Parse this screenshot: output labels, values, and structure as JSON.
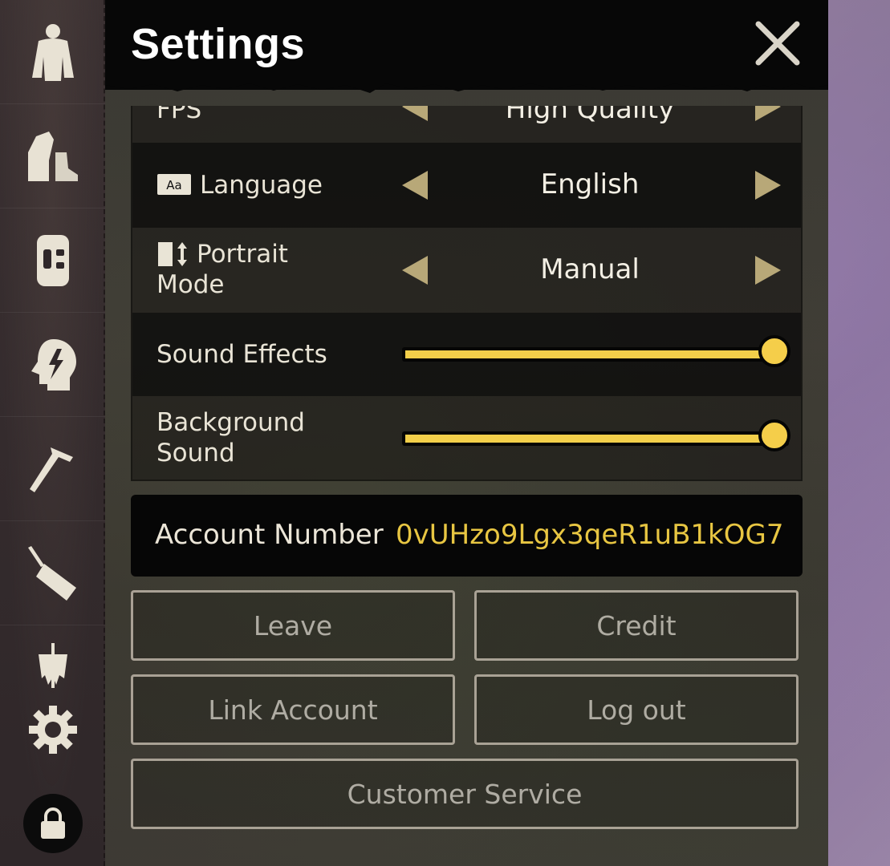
{
  "sidebar": {
    "items": [
      {
        "icon": "character-icon"
      },
      {
        "icon": "clothing-icon"
      },
      {
        "icon": "backpack-icon"
      },
      {
        "icon": "skills-icon"
      },
      {
        "icon": "crafting-icon"
      },
      {
        "icon": "radio-icon"
      },
      {
        "icon": "scarecrow-icon"
      },
      {
        "icon": "gear-icon"
      }
    ],
    "lock_icon": "lock-icon"
  },
  "header": {
    "title": "Settings",
    "close_icon": "close-icon"
  },
  "settings": {
    "partial_row": {
      "label": "FPS",
      "value": "High Quality"
    },
    "language": {
      "label": "Language",
      "value": "English",
      "icon": "language-icon"
    },
    "portrait_mode": {
      "label_line1": "Portrait",
      "label_line2": "Mode",
      "value": "Manual",
      "icon": "portrait-mode-icon"
    },
    "sound_effects": {
      "label": "Sound Effects",
      "level": 1.0
    },
    "background_sound": {
      "label_line1": "Background",
      "label_line2": "Sound",
      "level": 1.0
    }
  },
  "account": {
    "label": "Account Number",
    "value": "0vUHzo9Lgx3qeR1uB1kOG7"
  },
  "buttons": {
    "leave": "Leave",
    "credit": "Credit",
    "link_account": "Link Account",
    "log_out": "Log out",
    "customer_service": "Customer Service"
  },
  "colors": {
    "accent_yellow": "#f3cf4a",
    "arrow": "#b8a878",
    "header_bg": "#070707"
  }
}
